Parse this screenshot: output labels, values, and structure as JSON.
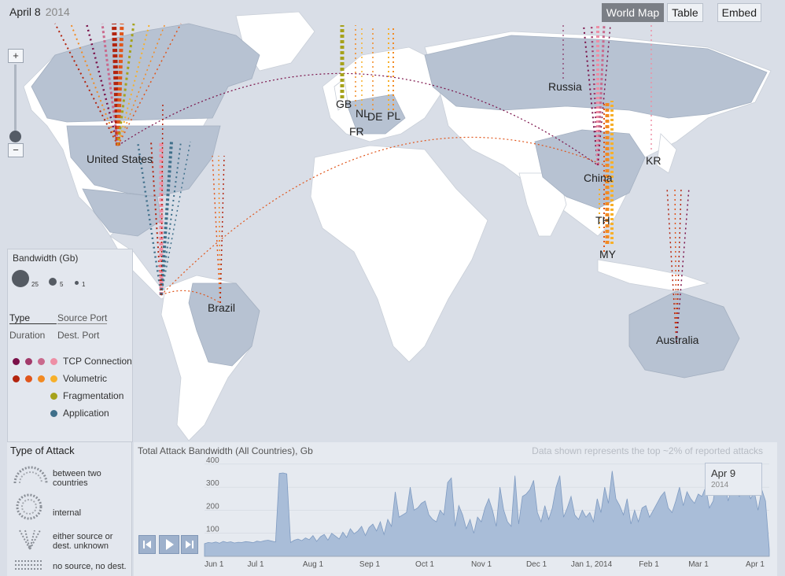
{
  "header": {
    "date": "April 8",
    "year": "2014"
  },
  "tabs": {
    "world_map": "World Map",
    "table": "Table",
    "embed": "Embed"
  },
  "zoom": {
    "plus": "+",
    "minus": "−"
  },
  "countries": {
    "us": "United States",
    "brazil": "Brazil",
    "gb": "GB",
    "fr": "FR",
    "nl": "NL",
    "de": "DE",
    "pl": "PL",
    "russia": "Russia",
    "china": "China",
    "kr": "KR",
    "th": "TH",
    "my": "MY",
    "australia": "Australia"
  },
  "legend": {
    "bandwidth_title": "Bandwidth (Gb)",
    "bw_values": [
      "25",
      "5",
      "1"
    ],
    "type": "Type",
    "source_port": "Source Port",
    "duration": "Duration",
    "dest_port": "Dest. Port",
    "types": [
      {
        "label": "TCP Connection",
        "colors": [
          "#7a1048",
          "#a23a6a",
          "#c96a8d",
          "#ee8fa5"
        ]
      },
      {
        "label": "Volumetric",
        "colors": [
          "#b3240e",
          "#e0561c",
          "#f28a22",
          "#f7b02a"
        ]
      },
      {
        "label": "Fragmentation",
        "colors": [
          "#a6a21b"
        ]
      },
      {
        "label": "Application",
        "colors": [
          "#3f6f8a"
        ]
      }
    ]
  },
  "type_of_attack": {
    "title": "Type of Attack",
    "items": [
      "between two countries",
      "internal",
      "either source or dest. unknown",
      "no source, no dest."
    ]
  },
  "chart": {
    "title": "Total Attack Bandwidth (All Countries), Gb",
    "note": "Data shown represents the top ~2% of reported attacks",
    "tooltip_date": "Apr 9",
    "tooltip_year": "2014",
    "colors": {
      "fill": "#a9bdd8",
      "stroke": "#7f9bc1"
    }
  },
  "chart_data": {
    "type": "area",
    "title": "Total Attack Bandwidth (All Countries), Gb",
    "xlabel": "",
    "ylabel": "",
    "x_ticks": [
      "Jun 1",
      "Jul 1",
      "Aug 1",
      "Sep 1",
      "Oct 1",
      "Nov 1",
      "Dec 1",
      "Jan 1, 2014",
      "Feb 1",
      "Mar 1",
      "Apr 1"
    ],
    "y_ticks": [
      100,
      200,
      300,
      400
    ],
    "ylim": [
      0,
      420
    ],
    "series": [
      {
        "values": [
          55,
          60,
          58,
          62,
          57,
          65,
          60,
          63,
          58,
          61,
          60,
          64,
          62,
          59,
          66,
          63,
          68,
          70,
          66,
          62,
          360,
          362,
          358,
          60,
          70,
          75,
          68,
          80,
          72,
          90,
          65,
          85,
          95,
          70,
          100,
          88,
          75,
          105,
          82,
          120,
          98,
          110,
          130,
          90,
          125,
          140,
          110,
          150,
          95,
          160,
          130,
          280,
          170,
          180,
          190,
          300,
          200,
          210,
          230,
          240,
          180,
          160,
          150,
          200,
          180,
          320,
          340,
          130,
          220,
          180,
          120,
          160,
          100,
          170,
          150,
          210,
          250,
          200,
          130,
          300,
          200,
          150,
          130,
          350,
          140,
          260,
          270,
          290,
          330,
          190,
          150,
          220,
          160,
          210,
          300,
          350,
          170,
          210,
          260,
          180,
          160,
          200,
          170,
          190,
          150,
          250,
          190,
          300,
          230,
          370,
          250,
          220,
          180,
          250,
          140,
          200,
          150,
          210,
          220,
          170,
          200,
          230,
          260,
          280,
          210,
          190,
          240,
          300,
          220,
          280,
          250,
          230,
          270,
          260,
          300,
          210,
          240,
          350,
          270,
          330,
          240,
          300,
          280,
          260,
          360,
          310,
          250,
          280,
          200,
          290,
          240,
          30
        ]
      }
    ]
  }
}
